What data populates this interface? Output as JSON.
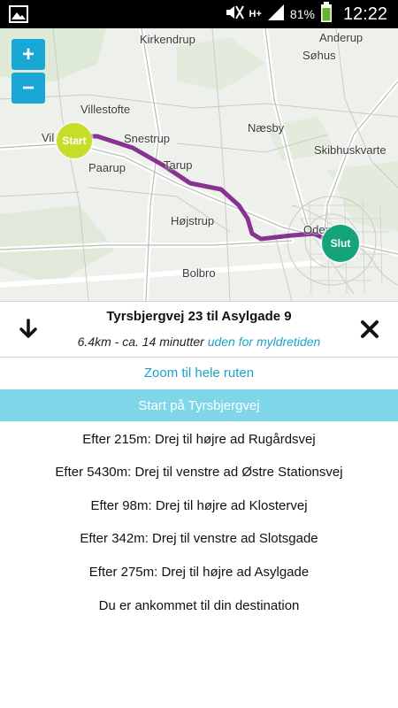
{
  "statusbar": {
    "network": "H+",
    "battery_percent": "81%",
    "time": "12:22",
    "icons": [
      "image-icon",
      "mute-icon",
      "signal-icon",
      "battery-icon"
    ]
  },
  "map": {
    "places": {
      "kirkendrup": "Kirkendrup",
      "anderup": "Anderup",
      "sohus": "Søhus",
      "villestofte": "Villestofte",
      "vil": "Vil",
      "snestrup": "Snestrup",
      "naesby": "Næsby",
      "skibhuskvarter": "Skibhuskvarte",
      "paarup": "Paarup",
      "tarup": "Tarup",
      "hojstrup": "Højstrup",
      "odense": "Odense",
      "bolbro": "Bolbro"
    },
    "zoom_in": "+",
    "zoom_out": "−",
    "start_marker": "Start",
    "end_marker": "Slut",
    "colors": {
      "route": "#7b1e86",
      "start": "#c8dc2a",
      "end": "#14a37a",
      "zoom": "#19a7d6"
    }
  },
  "route": {
    "title": "Tyrsbjergvej 23 til Asylgade 9",
    "summary": "6.4km - ca. 14 minutter",
    "traffic_note": "uden for myldretiden"
  },
  "directions": {
    "zoom_label": "Zoom til hele ruten",
    "start_label": "Start på Tyrsbjergvej",
    "steps": [
      "Efter 215m: Drej til højre ad Rugårdsvej",
      "Efter 5430m: Drej til venstre ad Østre Stationsvej",
      "Efter 98m: Drej til højre ad Klostervej",
      "Efter 342m: Drej til venstre ad Slotsgade",
      "Efter 275m: Drej til højre ad Asylgade",
      "Du er ankommet til din destination"
    ]
  }
}
